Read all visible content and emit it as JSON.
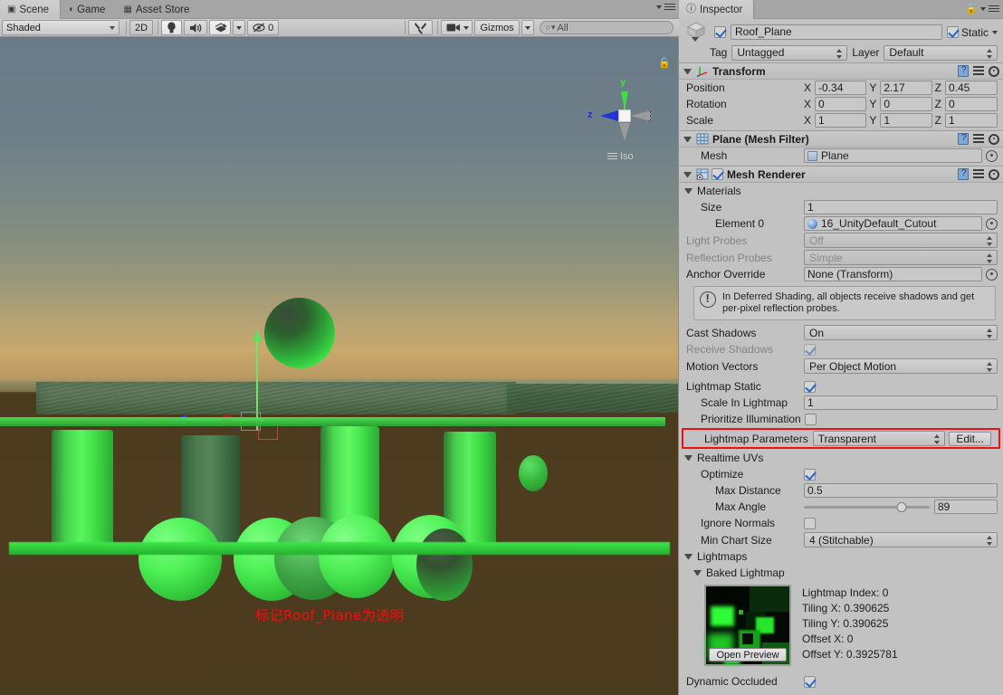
{
  "scene_panel": {
    "tabs": [
      {
        "label": "Scene",
        "icon": "grid-icon",
        "active": true
      },
      {
        "label": "Game",
        "icon": "gamepad-icon",
        "active": false
      },
      {
        "label": "Asset Store",
        "icon": "store-icon",
        "active": false
      }
    ],
    "toolbar": {
      "draw_mode": "Shaded",
      "two_d_button": "2D",
      "lighting_icon": "lightbulb-icon",
      "audio_icon": "speaker-icon",
      "fx_icon": "effects-icon",
      "hidden_objects_count": "0",
      "hidden_objects_icon": "eye-off-icon",
      "tools_icon": "tools-icon",
      "camera_icon": "camera-icon",
      "gizmos_label": "Gizmos",
      "search_placeholder": "All",
      "search_icon": "search-icon",
      "search_value": ""
    },
    "axis_gizmo": {
      "y_label": "y",
      "z_label": "z",
      "projection_label": "Iso",
      "lock_icon": "lock-icon"
    },
    "annotation": "标记Roof_Plane为透明"
  },
  "inspector": {
    "tab": {
      "label": "Inspector",
      "icon": "info-icon"
    },
    "lock_icon": "lock-icon",
    "menu_icon": "hamburger-icon",
    "object": {
      "icon": "cube-icon",
      "enabled": true,
      "name": "Roof_Plane",
      "static_label": "Static",
      "static_checked": true,
      "tag_label": "Tag",
      "tag_value": "Untagged",
      "layer_label": "Layer",
      "layer_value": "Default"
    },
    "components": [
      {
        "id": "transform",
        "title": "Transform",
        "icon": "transform-axis-icon",
        "expanded": true,
        "rows": [
          {
            "label": "Position",
            "x": "-0.34",
            "y": "2.17",
            "z": "0.45"
          },
          {
            "label": "Rotation",
            "x": "0",
            "y": "0",
            "z": "0"
          },
          {
            "label": "Scale",
            "x": "1",
            "y": "1",
            "z": "1"
          }
        ],
        "axis_labels": [
          "X",
          "Y",
          "Z"
        ]
      },
      {
        "id": "mesh-filter",
        "title": "Plane (Mesh Filter)",
        "icon": "mesh-filter-icon",
        "expanded": true,
        "mesh_label": "Mesh",
        "mesh_value": "Plane"
      },
      {
        "id": "mesh-renderer",
        "title": "Mesh Renderer",
        "icon": "mesh-renderer-icon",
        "expanded": true,
        "enabled": true
      }
    ],
    "materials": {
      "header": "Materials",
      "size_label": "Size",
      "size_value": "1",
      "element0_label": "Element 0",
      "element0_value": "16_UnityDefault_Cutout"
    },
    "probes": {
      "light_probes_label": "Light Probes",
      "light_probes_value": "Off",
      "reflection_probes_label": "Reflection Probes",
      "reflection_probes_value": "Simple",
      "anchor_override_label": "Anchor Override",
      "anchor_override_value": "None (Transform)"
    },
    "helpbox": {
      "icon": "warning-icon",
      "text": "In Deferred Shading, all objects receive shadows and get per-pixel reflection probes."
    },
    "shadows": {
      "cast_shadows_label": "Cast Shadows",
      "cast_shadows_value": "On",
      "receive_shadows_label": "Receive Shadows",
      "receive_shadows_checked": true,
      "motion_vectors_label": "Motion Vectors",
      "motion_vectors_value": "Per Object Motion"
    },
    "lightmapping": {
      "lightmap_static_label": "Lightmap Static",
      "lightmap_static_checked": true,
      "scale_in_lightmap_label": "Scale In Lightmap",
      "scale_in_lightmap_value": "1",
      "prioritize_illumination_label": "Prioritize Illumination",
      "prioritize_illumination_checked": false,
      "lightmap_parameters_label": "Lightmap Parameters",
      "lightmap_parameters_value": "Transparent",
      "edit_button": "Edit...",
      "highlight_color": "#ee1111"
    },
    "realtime_uvs": {
      "header": "Realtime UVs",
      "optimize_label": "Optimize",
      "optimize_checked": true,
      "max_distance_label": "Max Distance",
      "max_distance_value": "0.5",
      "max_angle_label": "Max Angle",
      "max_angle_value": "89",
      "ignore_normals_label": "Ignore Normals",
      "ignore_normals_checked": false,
      "min_chart_size_label": "Min Chart Size",
      "min_chart_size_value": "4 (Stitchable)"
    },
    "lightmaps": {
      "header": "Lightmaps",
      "baked_header": "Baked Lightmap",
      "open_preview_button": "Open Preview",
      "info": [
        "Lightmap Index: 0",
        "Tiling X: 0.390625",
        "Tiling Y: 0.390625",
        "Offset X: 0",
        "Offset Y: 0.3925781"
      ]
    },
    "dynamic_occluded": {
      "label": "Dynamic Occluded",
      "checked": true
    }
  }
}
